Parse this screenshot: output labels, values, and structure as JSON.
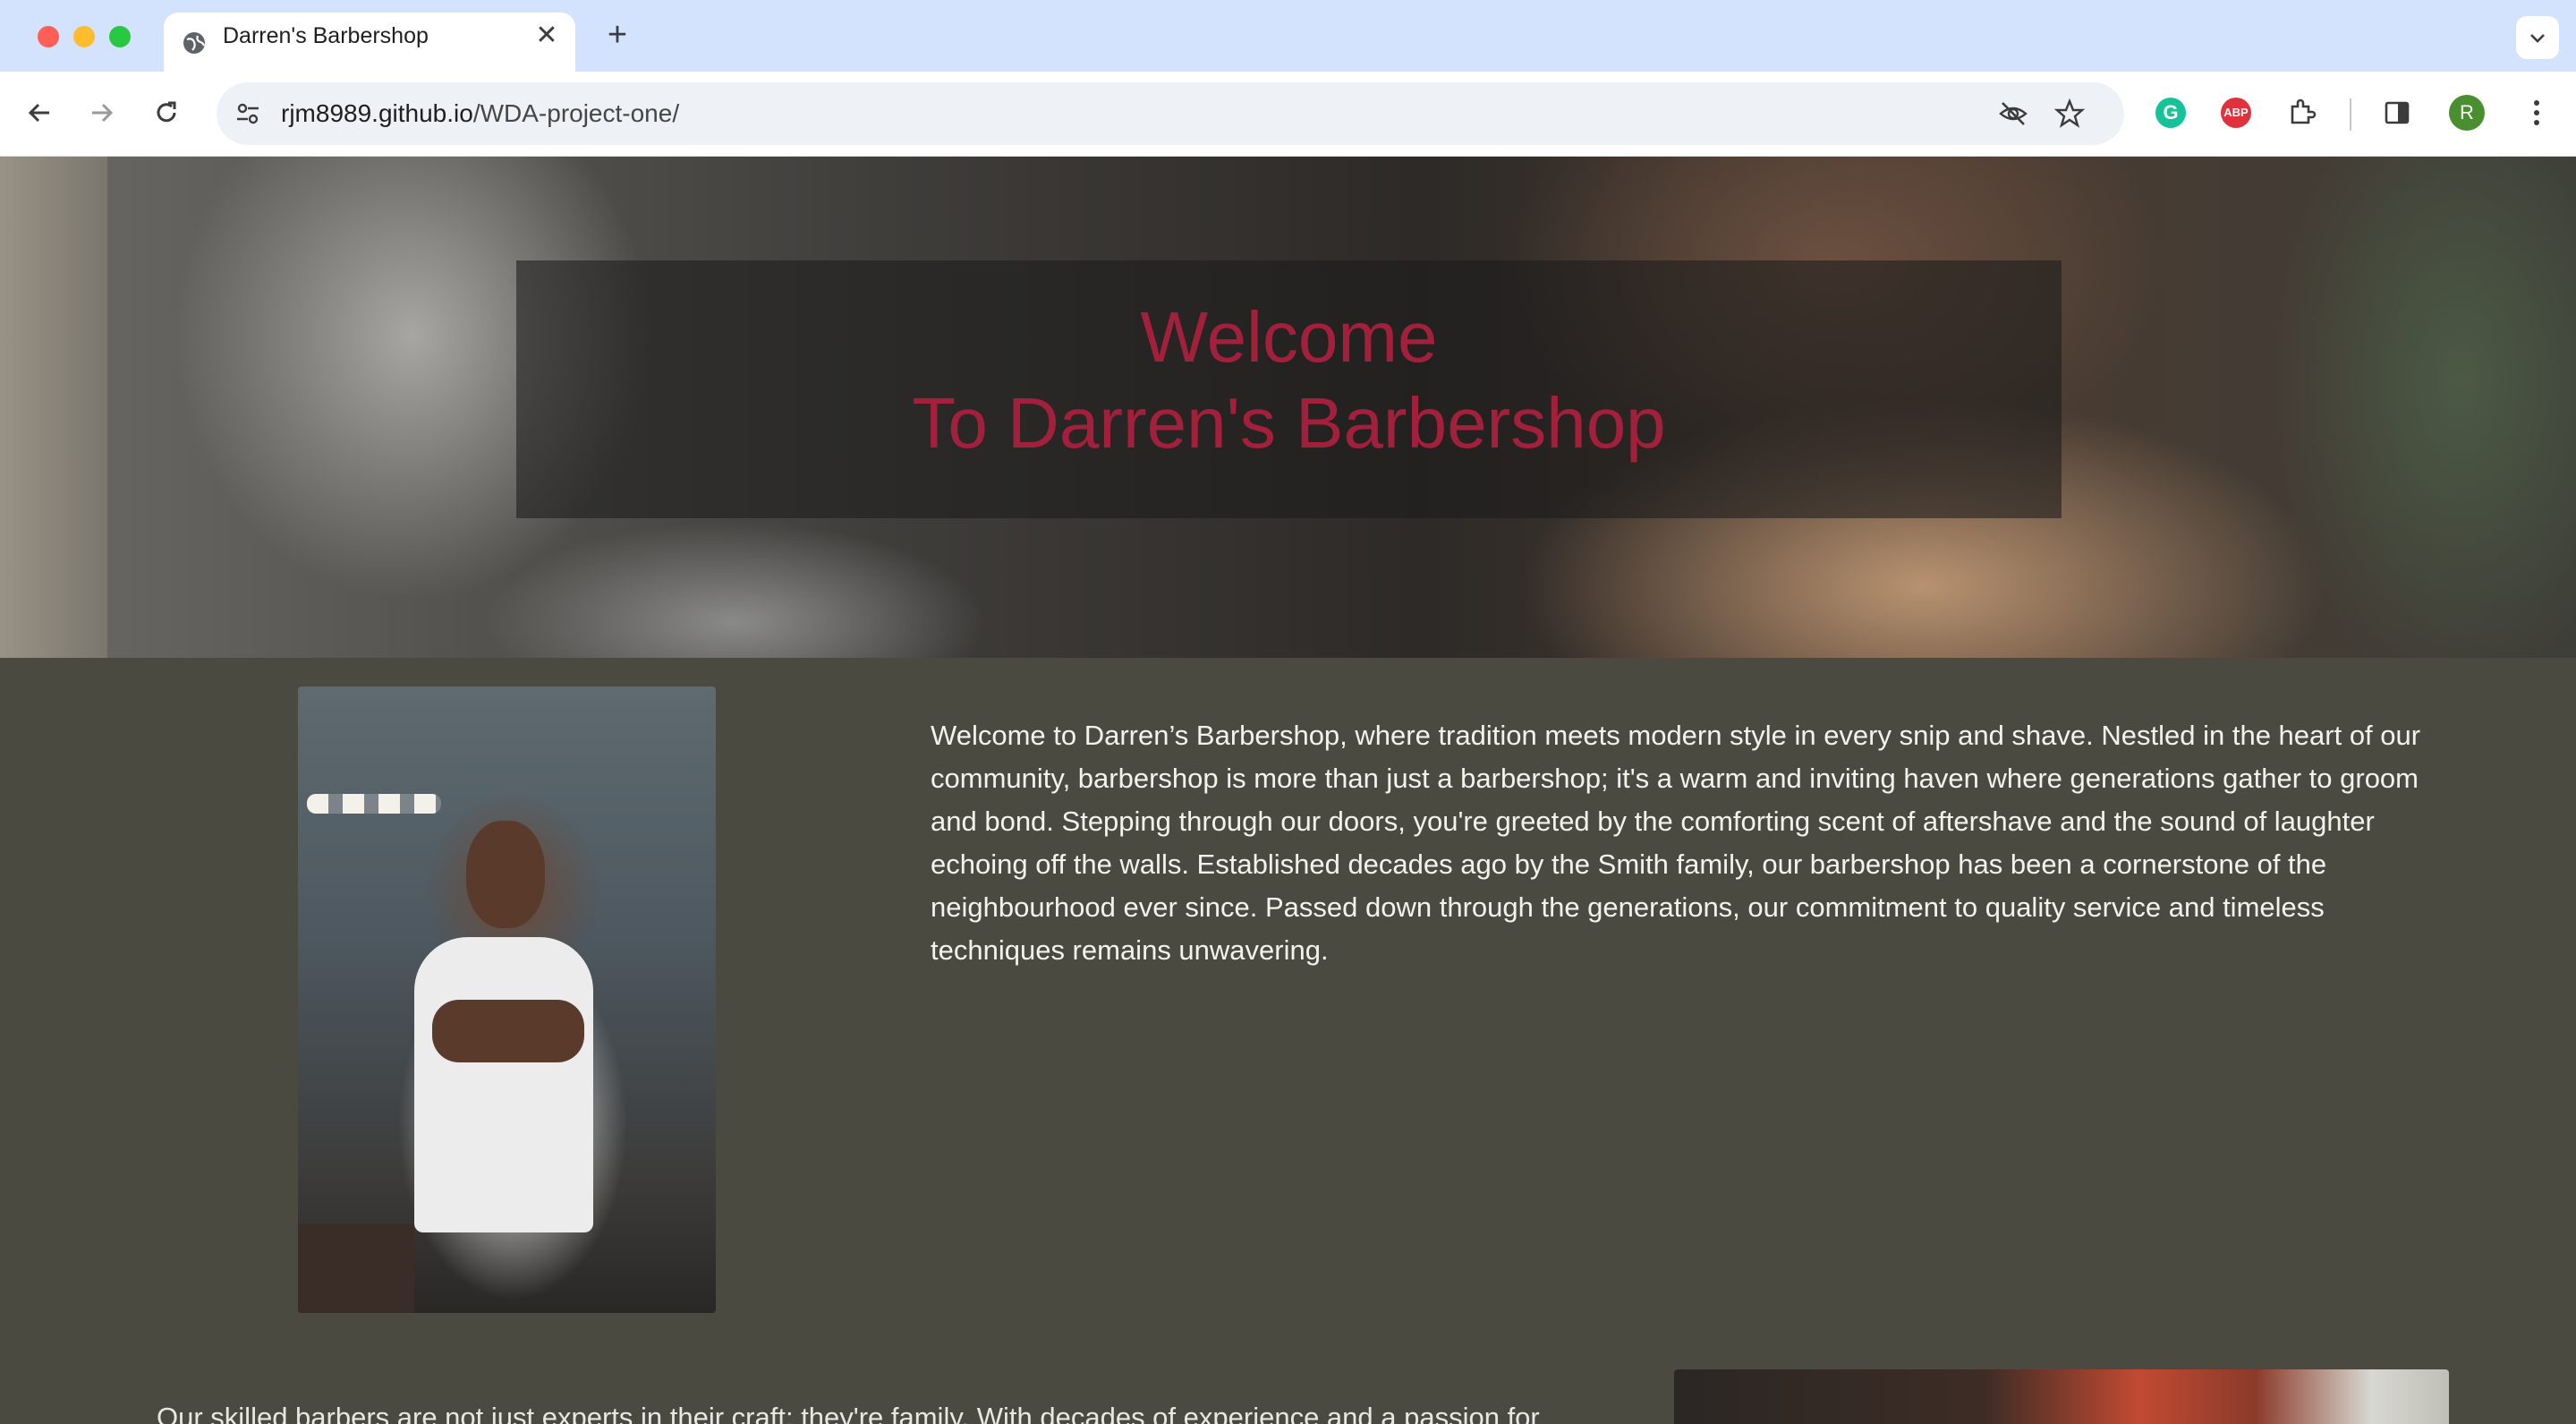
{
  "browser": {
    "tab": {
      "title": "Darren's Barbershop",
      "close_symbol": "✕"
    },
    "new_tab_symbol": "+",
    "address_bar": {
      "host": "rjm8989.github.io",
      "path": "/WDA-project-one/"
    },
    "profile_initial": "R",
    "extensions": {
      "abp_label": "ABP",
      "grammarly_label": "G"
    }
  },
  "hero": {
    "title_line1": "Welcome",
    "title_line2": "To Darren's Barbershop",
    "title_color": "#a3203c"
  },
  "about": {
    "paragraph": "Welcome to Darren’s Barbershop, where tradition meets modern style in every snip and shave. Nestled in the heart of our community, barbershop is more than just a barbershop; it's a warm and inviting haven where generations gather to groom and bond. Stepping through our doors, you're greeted by the comforting scent of aftershave and the sound of laughter echoing off the walls. Established decades ago by the Smith family, our barbershop has been a cornerstone of the neighbourhood ever since. Passed down through the generations, our commitment to quality service and timeless techniques remains unwavering."
  },
  "team": {
    "paragraph_start": "Our skilled barbers are not just experts in their craft; they're family. With decades of experience and a passion for"
  },
  "colors": {
    "page_background": "#4b4a40",
    "tab_strip": "#d3e3fd",
    "text": "#f3f3ee"
  }
}
